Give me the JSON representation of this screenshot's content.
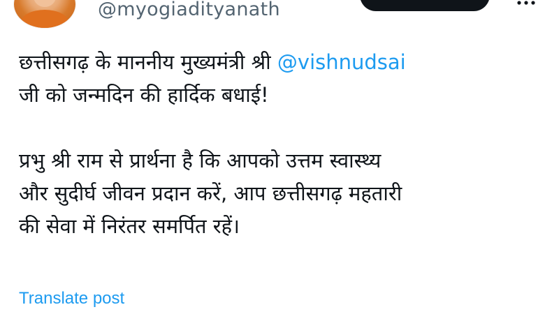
{
  "author": {
    "handle": "@myogiadityanath"
  },
  "tweet": {
    "paragraph1_line1": "छत्तीसगढ़ के माननीय मुख्यमंत्री श्री",
    "mention": "@vishnudsai",
    "paragraph1_line2": "जी को जन्मदिन की हार्दिक बधाई!",
    "paragraph2_line1": "प्रभु श्री राम से प्रार्थना है कि आपको उत्तम स्वास्थ्य",
    "paragraph2_line2": "और सुदीर्घ जीवन प्रदान करें, आप छत्तीसगढ़ महतारी",
    "paragraph2_line3": "की सेवा में निरंतर समर्पित रहें।"
  },
  "actions": {
    "translate_label": "Translate post"
  },
  "icons": {
    "more": "more-horizontal-icon"
  },
  "colors": {
    "text": "#0f1419",
    "secondary_text": "#536471",
    "link": "#1d9bf0",
    "button_dark": "#0f1419"
  }
}
